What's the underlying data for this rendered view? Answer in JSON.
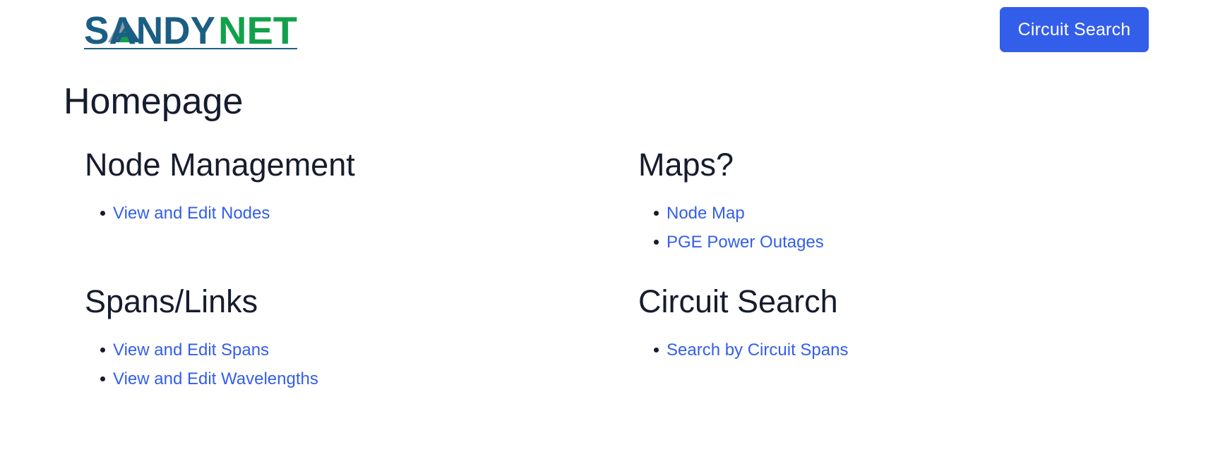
{
  "brand": {
    "logo_text_part1": "SANDY",
    "logo_text_part2": "NET",
    "colors": {
      "blue": "#1b5e85",
      "green": "#12a14a",
      "mountain_gray": "#8c9aa6"
    }
  },
  "navbar": {
    "cta_label": "Circuit Search",
    "cta_color": "#335eea"
  },
  "page": {
    "title": "Homepage"
  },
  "sections": {
    "node_management": {
      "heading": "Node Management",
      "links": [
        "View and Edit Nodes"
      ]
    },
    "maps": {
      "heading": "Maps?",
      "links": [
        "Node Map",
        "PGE Power Outages"
      ]
    },
    "spans_links": {
      "heading": "Spans/Links",
      "links": [
        "View and Edit Spans",
        "View and Edit Wavelengths"
      ]
    },
    "circuit_search": {
      "heading": "Circuit Search",
      "links": [
        "Search by Circuit Spans"
      ]
    }
  },
  "theme": {
    "link_color": "#335eea",
    "text_color": "#161c2d"
  }
}
